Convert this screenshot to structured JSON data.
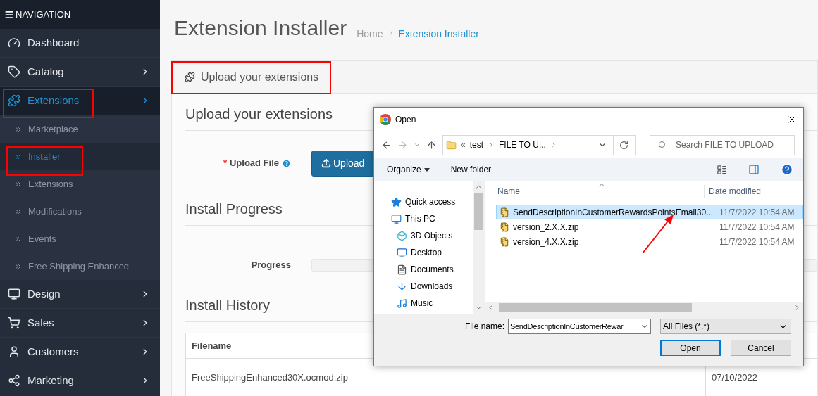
{
  "sidebar": {
    "header": "NAVIGATION",
    "items": [
      {
        "label": "Dashboard",
        "expandable": false,
        "selected": false
      },
      {
        "label": "Catalog",
        "expandable": true,
        "selected": false
      },
      {
        "label": "Extensions",
        "expandable": true,
        "selected": true,
        "children": [
          {
            "label": "Marketplace",
            "selected": false
          },
          {
            "label": "Installer",
            "selected": true
          },
          {
            "label": "Extensions",
            "selected": false
          },
          {
            "label": "Modifications",
            "selected": false
          },
          {
            "label": "Events",
            "selected": false
          },
          {
            "label": "Free Shipping Enhanced",
            "selected": false
          }
        ]
      },
      {
        "label": "Design",
        "expandable": true,
        "selected": false
      },
      {
        "label": "Sales",
        "expandable": true,
        "selected": false
      },
      {
        "label": "Customers",
        "expandable": true,
        "selected": false
      },
      {
        "label": "Marketing",
        "expandable": true,
        "selected": false
      }
    ]
  },
  "page": {
    "title": "Extension Installer",
    "breadcrumbs": [
      "Home",
      "Extension Installer"
    ],
    "panel_heading": "Upload your extensions",
    "upload_section": {
      "title": "Upload your extensions",
      "label": "Upload File",
      "required_mark": "*",
      "button": "Upload"
    },
    "progress_section": {
      "title": "Install Progress",
      "label": "Progress",
      "level": 0
    },
    "history_section": {
      "title": "Install History",
      "columns": [
        "Filename"
      ],
      "rows": [
        [
          "FreeShippingEnhanced30X.ocmod.zip",
          "07/10/2022"
        ]
      ]
    }
  },
  "dialog": {
    "title": "Open",
    "path_prefix": "«",
    "path": [
      "test",
      "FILE TO U..."
    ],
    "search": {
      "placeholder": "Search FILE TO UPLOAD"
    },
    "toolbar": [
      "Organize",
      "New folder"
    ],
    "tree": [
      {
        "label": "Quick access"
      },
      {
        "label": "This PC",
        "children": [
          {
            "label": "3D Objects"
          },
          {
            "label": "Desktop"
          },
          {
            "label": "Documents"
          },
          {
            "label": "Downloads"
          },
          {
            "label": "Music"
          }
        ]
      }
    ],
    "columns": [
      "Name",
      "Date modified"
    ],
    "files": [
      {
        "name": "SendDescriptionInCustomerRewardsPointsEmail30...",
        "date": "11/7/2022 10:54 AM",
        "selected": true
      },
      {
        "name": "version_2.X.X.zip",
        "date": "11/7/2022 10:54 AM",
        "selected": false
      },
      {
        "name": "version_4.X.X.zip",
        "date": "11/7/2022 10:54 AM",
        "selected": false
      }
    ],
    "file_name_label": "File name:",
    "file_name": "SendDescriptionInCustomerRewar",
    "filter": "All Files (*.*)",
    "buttons": [
      "Open",
      "Cancel"
    ]
  }
}
